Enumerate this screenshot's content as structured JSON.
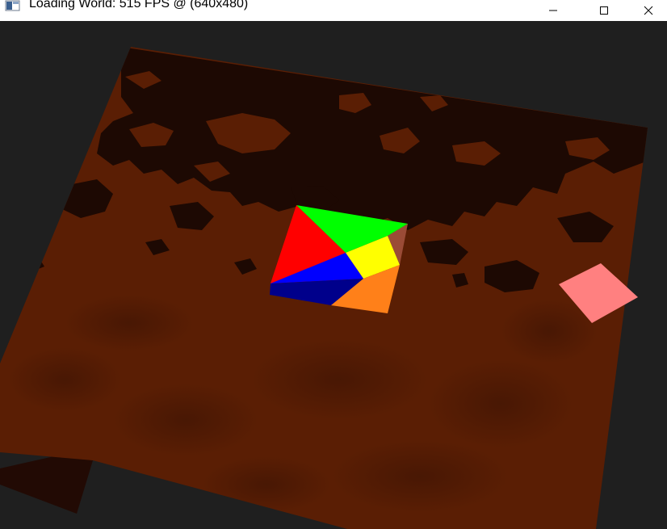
{
  "window": {
    "title": "Loading World: 515 FPS @ (640x480)",
    "icon": "app-window-icon",
    "controls": {
      "minimize_icon": "minimize-icon",
      "maximize_icon": "maximize-icon",
      "close_icon": "close-icon"
    }
  },
  "scene": {
    "background_color": "#1f1f1f",
    "terrain_color": "#5a1e04",
    "terrain_dark_color": "#1d0903",
    "terrain_side_color": "#220a04",
    "pyramid_faces": {
      "red": "#ff0000",
      "green": "#00ff00",
      "yellow": "#ffff00",
      "blue": "#0000ff",
      "navy": "#00008b",
      "orange": "#ff8019",
      "brown": "#9a4b36"
    },
    "pink_square_color": "#ff8080"
  }
}
